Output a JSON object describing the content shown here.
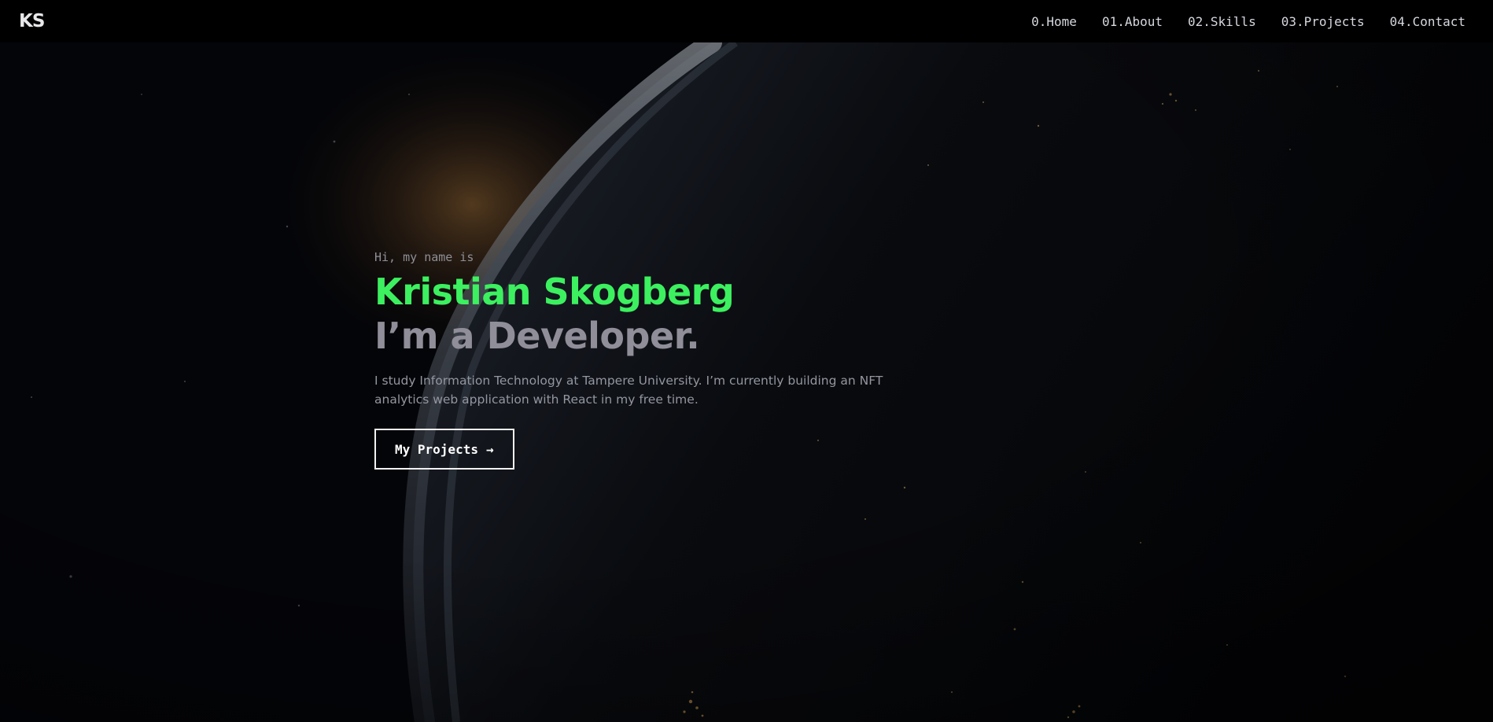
{
  "navbar": {
    "logo": "KS",
    "links": [
      {
        "label": "0.Home"
      },
      {
        "label": "01.About"
      },
      {
        "label": "02.Skills"
      },
      {
        "label": "03.Projects"
      },
      {
        "label": "04.Contact"
      }
    ]
  },
  "hero": {
    "greeting": "Hi, my name is",
    "name": "Kristian Skogberg",
    "role": "I’m a Developer.",
    "bio": "I study Information Technology at Tampere University. I’m currently building an NFT analytics web application with React in my free time.",
    "cta": {
      "label": "My Projects",
      "arrow": "→"
    }
  },
  "colors": {
    "accent": "#3cf05f",
    "background": "#05060a",
    "navbar": "#000000",
    "muted": "#8f8e99"
  }
}
